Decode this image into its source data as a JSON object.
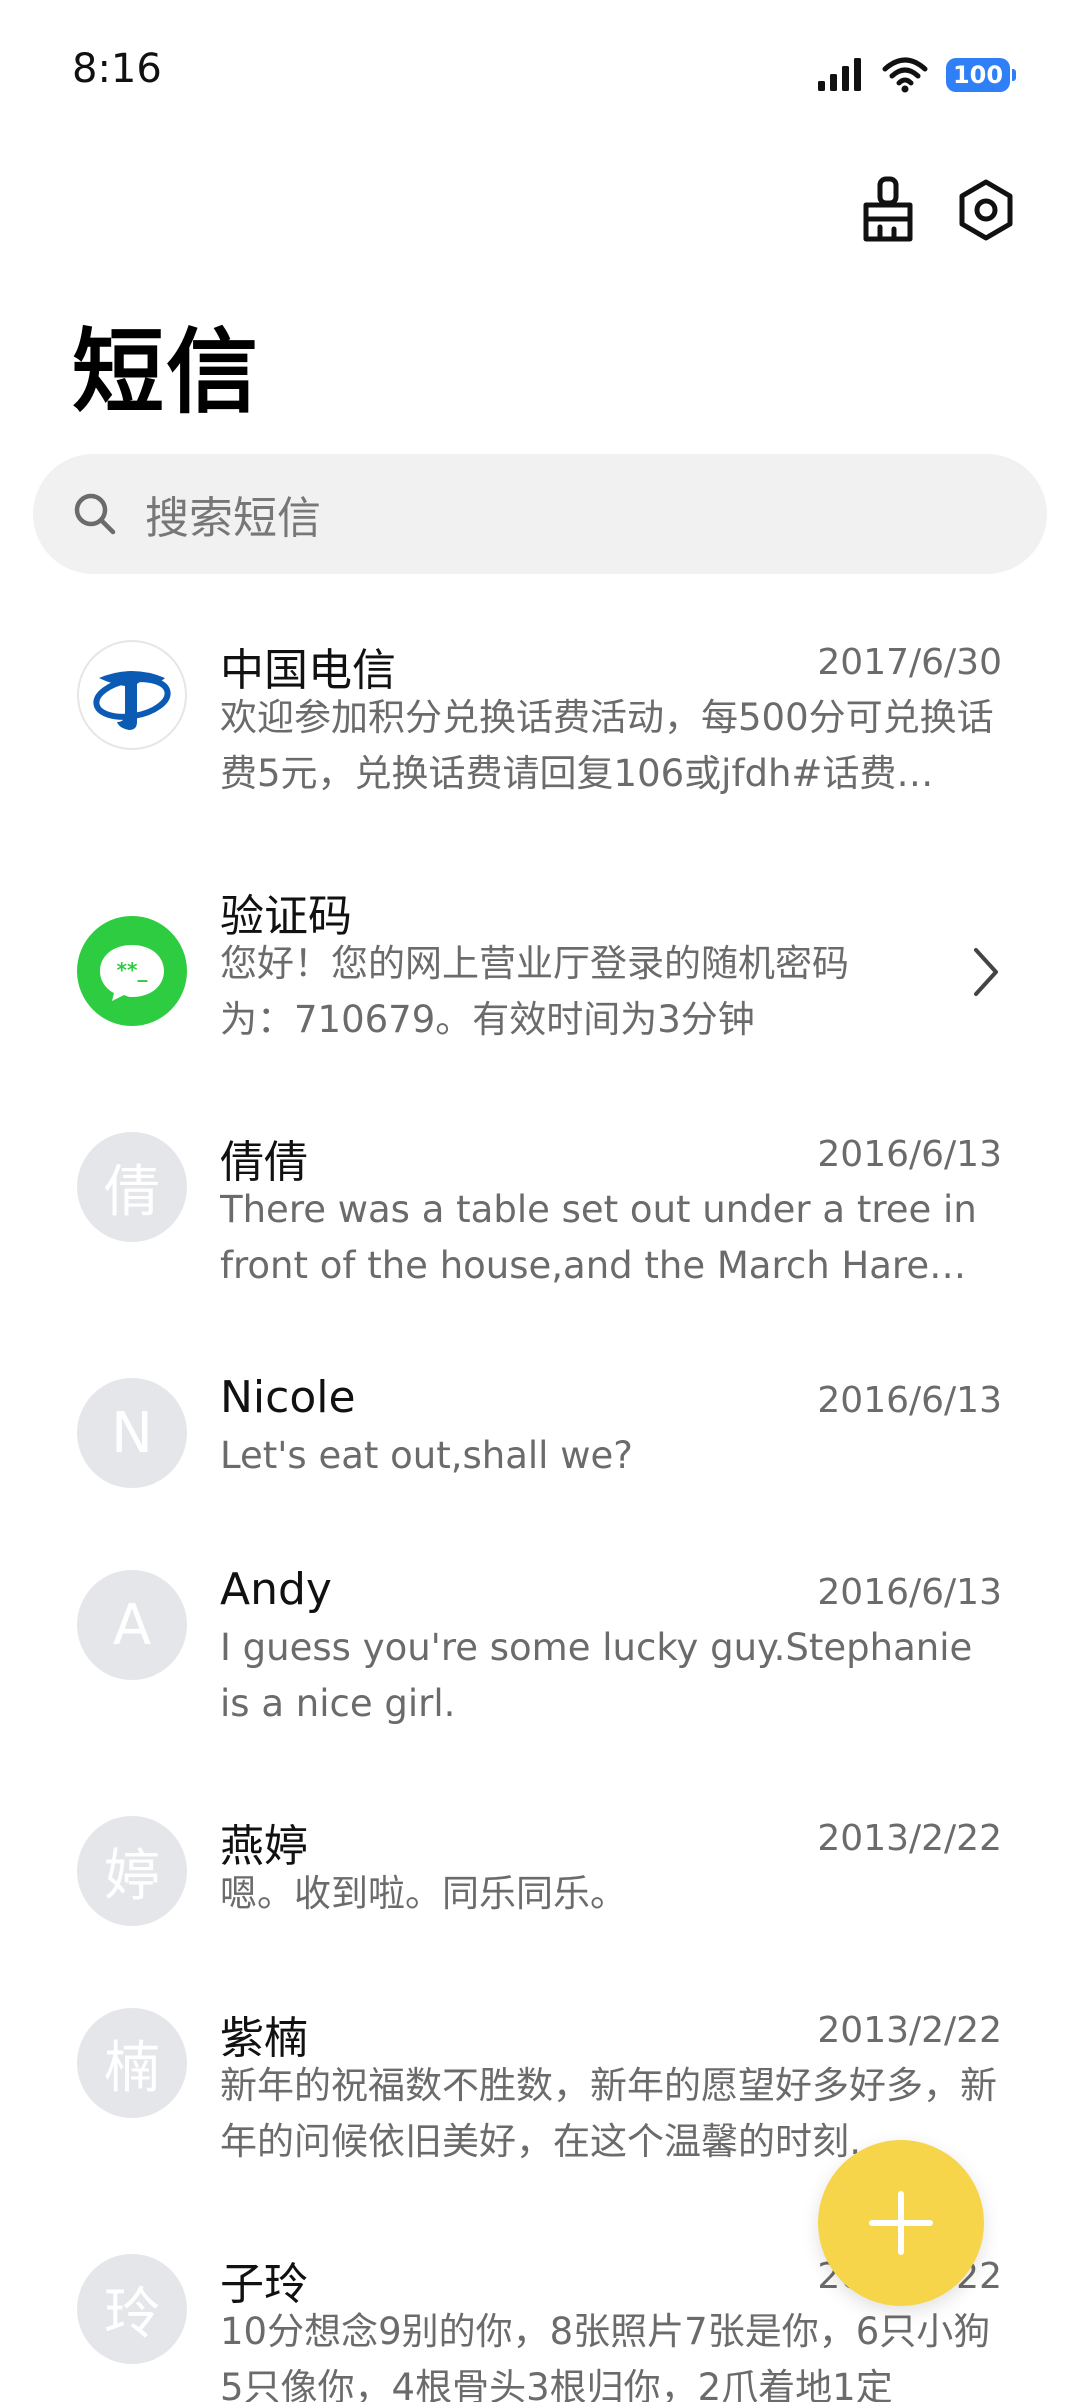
{
  "status_bar": {
    "time": "8:16",
    "battery": "100"
  },
  "header": {
    "title": "短信",
    "clean_icon": "broom-icon",
    "settings_icon": "settings-hexagon-icon"
  },
  "search": {
    "placeholder": "搜索短信"
  },
  "conversations": [
    {
      "name": "中国电信",
      "date": "2017/6/30",
      "preview": "欢迎参加积分兑换话费活动，每500分可兑换话费5元，兑换话费请回复106或jfdh#话费…",
      "avatar": "china-telecom-logo"
    },
    {
      "name": "验证码",
      "date": "",
      "preview": "您好！您的网上营业厅登录的随机密码为：710679。有效时间为3分钟",
      "avatar": "verification-code-icon"
    },
    {
      "name": "倩倩",
      "date": "2016/6/13",
      "preview": "There was a table set out under a tree in front of the house,and the March Hare an…",
      "avatar_letter": "倩"
    },
    {
      "name": "Nicole",
      "date": "2016/6/13",
      "preview": "Let's eat out,shall we?",
      "avatar_letter": "N"
    },
    {
      "name": "Andy",
      "date": "2016/6/13",
      "preview": "I guess you're some lucky guy.Stephanie is a nice girl.",
      "avatar_letter": "A"
    },
    {
      "name": "燕婷",
      "date": "2013/2/22",
      "preview": "嗯。收到啦。同乐同乐。",
      "avatar_letter": "婷"
    },
    {
      "name": "紫楠",
      "date": "2013/2/22",
      "preview": "新年的祝福数不胜数，新年的愿望好多好多，新年的问候依旧美好，在这个温馨的时刻…",
      "avatar_letter": "楠"
    },
    {
      "name": "子玲",
      "date": "2013/2/22",
      "preview": "10分想念9别的你，8张照片7张是你，6只小狗5只像你，4根骨头3根归你，2爪着地1定",
      "avatar_letter": "玲"
    }
  ],
  "fab": {
    "icon": "plus-icon"
  },
  "colors": {
    "accent_fab": "#f7d54a",
    "battery": "#2f7ff7",
    "telecom_blue": "#0b5bb5",
    "verification_green": "#2ecc40"
  }
}
